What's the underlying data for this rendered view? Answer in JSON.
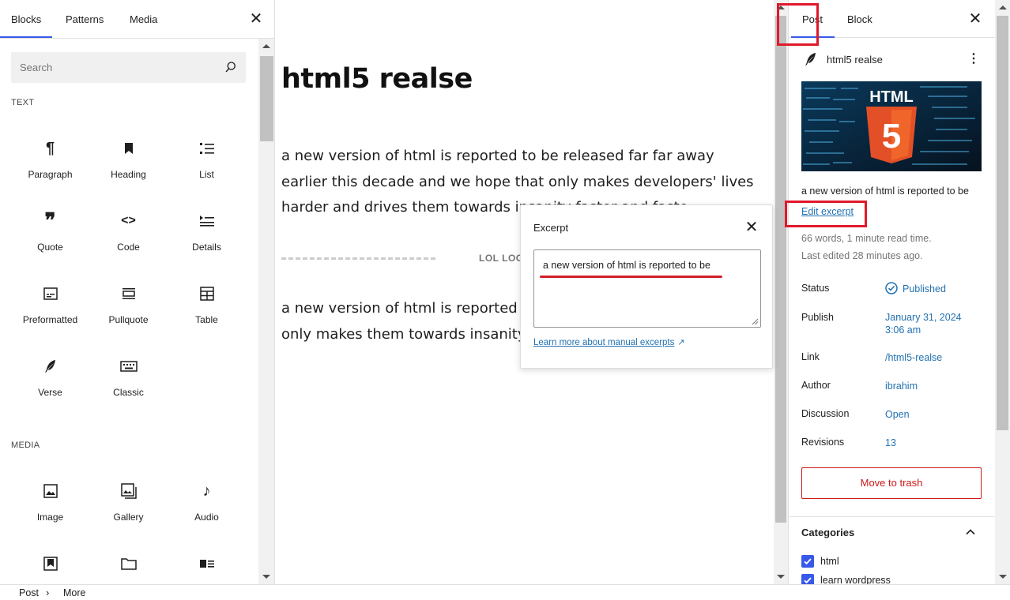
{
  "inserter": {
    "tabs": [
      "Blocks",
      "Patterns",
      "Media"
    ],
    "search_placeholder": "Search",
    "text_category": "TEXT",
    "media_category": "MEDIA",
    "text_blocks": [
      "Paragraph",
      "Heading",
      "List",
      "Quote",
      "Code",
      "Details",
      "Preformatted",
      "Pullquote",
      "Table",
      "Verse",
      "Classic"
    ],
    "media_blocks": [
      "Image",
      "Gallery",
      "Audio"
    ]
  },
  "editor": {
    "title": "html5 realse",
    "paragraph1": "a new version of html is reported to be released far far away earlier this decade and we hope that only makes developers' lives harder and drives them towards insanity faster and faste",
    "more_label": "LOL LOO",
    "paragraph2": "a new version of html is reported to be decade and we hope that only makes them towards insanity faster and faste"
  },
  "excerpt_popover": {
    "title": "Excerpt",
    "value": "a new version of html is reported to be",
    "learn_more": "Learn more about manual excerpts",
    "learn_more_arrow": "↗"
  },
  "sidebar": {
    "tabs": [
      "Post",
      "Block"
    ],
    "post_title": "html5 realse",
    "featured_image_text": "HTML",
    "featured_image_badge": "5",
    "excerpt_preview": "a new version of html is reported to be",
    "edit_excerpt": "Edit excerpt",
    "word_count": "66 words, 1 minute read time.",
    "last_edited": "Last edited 28 minutes ago.",
    "rows": {
      "status": {
        "label": "Status",
        "value": "Published"
      },
      "publish": {
        "label": "Publish",
        "value_line1": "January 31, 2024",
        "value_line2": "3:06 am"
      },
      "link": {
        "label": "Link",
        "value": "/html5-realse"
      },
      "author": {
        "label": "Author",
        "value": "ibrahim"
      },
      "discussion": {
        "label": "Discussion",
        "value": "Open"
      },
      "revisions": {
        "label": "Revisions",
        "value": "13"
      }
    },
    "trash_button": "Move to trash",
    "categories_title": "Categories",
    "categories": [
      "html",
      "learn wordpress"
    ]
  },
  "footer": {
    "crumb1": "Post",
    "crumb2": "More",
    "separator": "›"
  },
  "colors": {
    "accent": "#3858e9",
    "link": "#2271b1",
    "danger": "#cc1818",
    "highlight": "#e0192b"
  }
}
